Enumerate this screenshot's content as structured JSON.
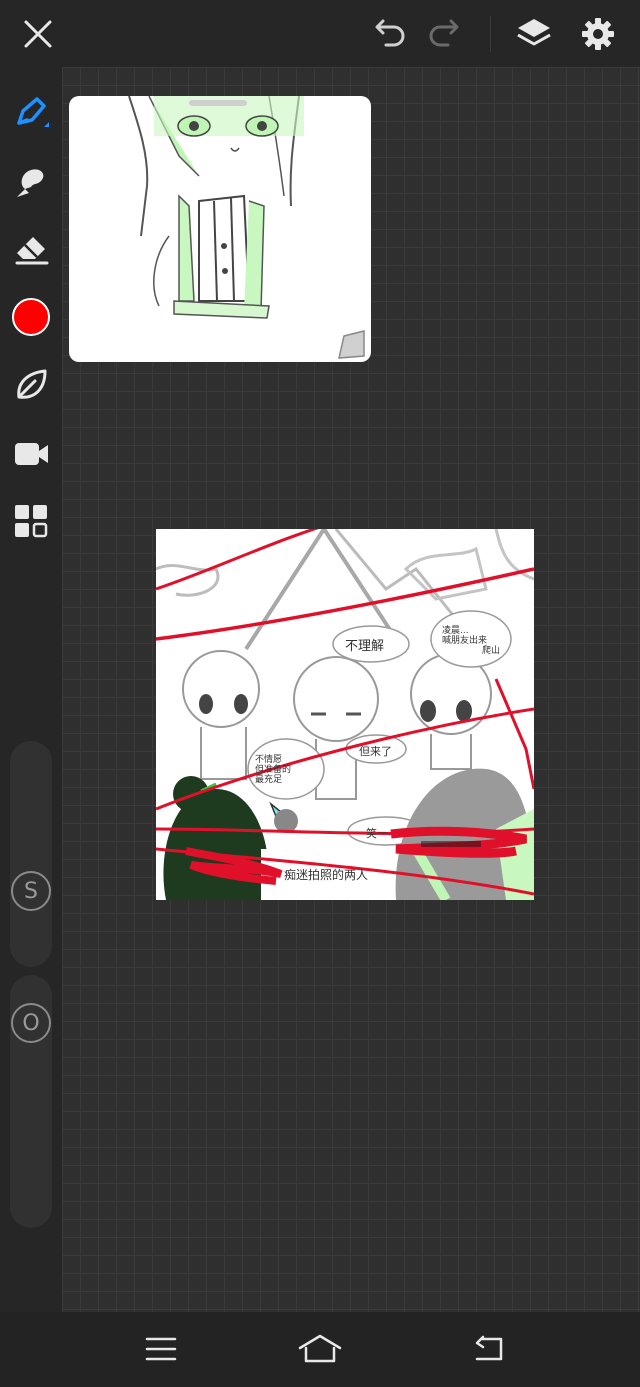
{
  "toolbar": {
    "close_icon": "close-icon",
    "undo_icon": "undo-icon",
    "redo_icon": "redo-icon",
    "layers_icon": "layers-icon",
    "settings_icon": "gear-icon"
  },
  "tools": [
    {
      "name": "pen",
      "icon": "pen-icon",
      "active": true,
      "accent": "#1e90ff"
    },
    {
      "name": "smudge",
      "icon": "brush-icon"
    },
    {
      "name": "eraser",
      "icon": "eraser-icon"
    },
    {
      "name": "color",
      "icon": "color-swatch",
      "color": "#ff0000"
    },
    {
      "name": "shape",
      "icon": "leaf-icon"
    },
    {
      "name": "record",
      "icon": "video-icon"
    },
    {
      "name": "gallery",
      "icon": "grid-icon"
    }
  ],
  "sliders": {
    "size_label": "S",
    "opacity_label": "O"
  },
  "artwork": {
    "bubble_1": "不理解",
    "bubble_2_line1": "凌晨...",
    "bubble_2_line2": "喊朋友出来",
    "bubble_2_line3": "爬山",
    "bubble_3_line1": "不情愿",
    "bubble_3_line2": "但准备的",
    "bubble_3_line3": "最充足",
    "bubble_4": "但来了",
    "bubble_5": "笑一",
    "caption": "痴迷拍照的两人"
  },
  "navbar": {
    "menu_icon": "menu-icon",
    "home_icon": "home-icon",
    "back_icon": "back-icon"
  },
  "colors": {
    "background": "#262626",
    "canvas": "#2f2f2f",
    "accent": "#1e90ff",
    "brush_color": "#ff0000"
  }
}
